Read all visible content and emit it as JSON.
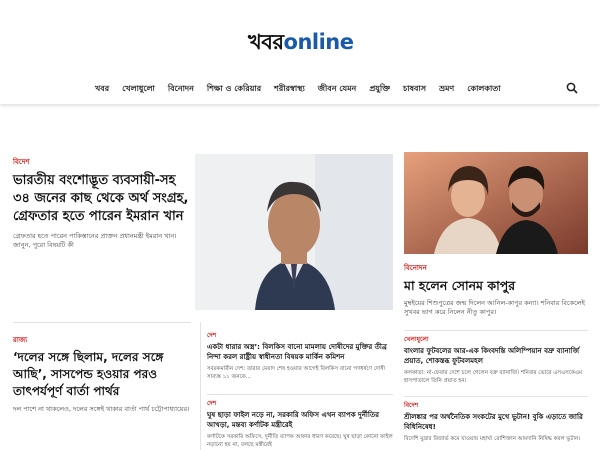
{
  "logo": {
    "part1": "খবর",
    "part2": "online"
  },
  "nav": [
    "খবর",
    "খেলাধুলো",
    "বিনোদন",
    "শিক্ষা ও কেরিয়ার",
    "শরীরস্বাস্থ্য",
    "জীবন যেমন",
    "প্রযুক্তি",
    "চাষবাস",
    "ভ্রমণ",
    "কোলকাতা"
  ],
  "lead": {
    "kicker": "বিদেশ",
    "title": "ভারতীয় বংশোদ্ভূত ব্যবসায়ী-সহ ৩৪ জনের কাছ থেকে অর্থ সংগ্রহ, গ্রেফতার হতে পারেন ইমরান খান",
    "summary": "গ্রেফতার হতে পারেন পাকিস্তানের প্রাক্তন প্রধানমন্ত্রী ইমরান খান। জানুন, পুরো বিষয়টি কী"
  },
  "right_top": {
    "kicker": "বিনোদন",
    "title": "মা হলেন সোনম কাপুর",
    "summary": "মুম্বইয়ের শিশুপুত্রের জন্ম দিলেন আনিল-কাপুর কন্যা। শনিবার বিকেলেই সুখবর ভাগ করে নিলেন নীতু কাপুর।"
  },
  "left_bottom": {
    "kicker": "রাজ্য",
    "title": "‘দলের সঙ্গে ছিলাম, দলের সঙ্গে আছি’, সাসপেন্ড হওয়ার পরও তাৎপর্যপূর্ণ বার্তা পার্থর",
    "summary": "দল পাশে না থাকলেও, দলের সঙ্গেই থাকার বার্তা পার্থ চট্টোপাধ্যায়ের।"
  },
  "mid1": {
    "kicker": "দেশ",
    "title": "একটা ধারার অস্ত্র’: বিলকিস বানো মামলায় দোষীদের মুক্তির তীব্র নিন্দা করল রাষ্ট্রীয় স্বাধীনতা বিষয়ক মার্কিন কমিশন",
    "summary": "সবরকমারীন দেশ: তারার মেয়াদ শেষ হওয়ার আগেই বিলকিস বানো গণধর্ষণে দোষী সাব্যস্ত ১১ জনকে..."
  },
  "mid2": {
    "kicker": "দেশ",
    "title": "ঘুষ ছাড়া ফাইল নড়ে না, সরকারি অফিস এখন ব্যাপক দুর্নীতির আখড়া, মন্তব্য কর্ণাটক মন্ত্রীরেই",
    "summary": "কর্ণাটকে সরকারি অফিসে, দুর্নীতি ব্যাপক আকার ধারণ করেছে। ঘুষ ছাড়া কোনো ফাইল নড়ানো হয় না, বলছে মন্ত্রীরেই"
  },
  "right_mid": {
    "kicker": "খেলাধুলো",
    "title": "বাংলার ফুটবলের আর-এক কিংবদন্তি অলিম্পিয়ান বদ্রু ব্যানার্জি প্রয়াত, শোকস্তব্ধ ফুটবলমহল",
    "summary": "কলকাতা: না-ফেরার দেশে চলে গেলেন বদ্রু ব্যানার্জি। শনিবার ভোরে এসএসকেএম হাসপাতালে তিনি প্রয়াত হন।"
  },
  "right_bottom": {
    "kicker": "বিদেশ",
    "title": "শ্রীলঙ্কার পর অর্থনৈতিক সংকটের মুখে ভুটান! বুকি এড়াতে জারি বিধিনিষেধ!",
    "summary": "বিদেশি মুদ্রার রিজার্ভ কমে যাওয়ায় মহার্ঘ্য রোশিক্তান আমদানি নিষিদ্ধ করল ভুটান।"
  }
}
